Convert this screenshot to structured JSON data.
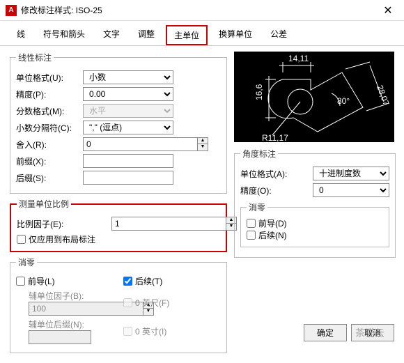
{
  "window": {
    "title": "修改标注样式: ISO-25"
  },
  "tabs": [
    "线",
    "符号和箭头",
    "文字",
    "调整",
    "主单位",
    "换算单位",
    "公差"
  ],
  "linear": {
    "legend": "线性标注",
    "unit_format_lbl": "单位格式(U):",
    "unit_format": "小数",
    "precision_lbl": "精度(P):",
    "precision": "0.00",
    "fraction_lbl": "分数格式(M):",
    "fraction": "水平",
    "decimal_sep_lbl": "小数分隔符(C):",
    "decimal_sep": "\",\"  (逗点)",
    "round_lbl": "舍入(R):",
    "round": "0",
    "prefix_lbl": "前缀(X):",
    "prefix": "",
    "suffix_lbl": "后缀(S):",
    "suffix": ""
  },
  "scale": {
    "legend": "测量单位比例",
    "factor_lbl": "比例因子(E):",
    "factor": "1",
    "layout_only": "仅应用到布局标注"
  },
  "zero_l": {
    "legend": "消零",
    "leading": "前导(L)",
    "trailing": "后续(T)",
    "aux_factor_lbl": "辅单位因子(B):",
    "aux_factor": "100",
    "feet": "0 英尺(F)",
    "aux_suffix_lbl": "辅单位后缀(N):",
    "inch": "0 英寸(I)"
  },
  "angular": {
    "legend": "角度标注",
    "unit_format_lbl": "单位格式(A):",
    "unit_format": "十进制度数",
    "precision_lbl": "精度(O):",
    "precision": "0"
  },
  "zero_a": {
    "legend": "消零",
    "leading": "前导(D)",
    "trailing": "后续(N)"
  },
  "preview": {
    "d1": "14,11",
    "d2": "16,6",
    "d3": "28,07",
    "r": "R11,17",
    "ang": "80°"
  },
  "buttons": {
    "ok": "确定",
    "cancel": "取消"
  },
  "watermark": "茶猫云"
}
